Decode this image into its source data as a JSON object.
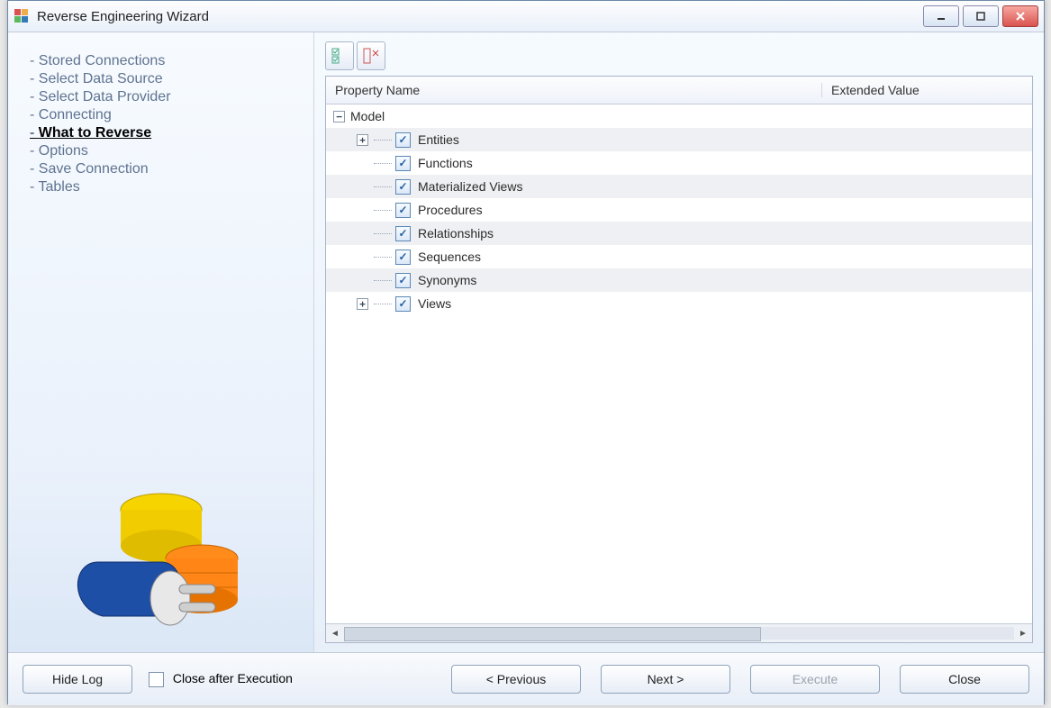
{
  "window": {
    "title": "Reverse Engineering Wizard"
  },
  "sidebar": {
    "steps": [
      "Stored Connections",
      "Select Data Source",
      "Select Data Provider",
      "Connecting",
      "What to Reverse",
      "Options",
      "Save Connection",
      "Tables"
    ],
    "current_index": 4
  },
  "toolbar": {
    "check_all": "check-all",
    "uncheck_all": "uncheck-all"
  },
  "grid": {
    "columns": {
      "property": "Property Name",
      "extended": "Extended Value"
    },
    "root": "Model",
    "items": [
      {
        "label": "Entities",
        "checked": true,
        "expandable": true
      },
      {
        "label": "Functions",
        "checked": true,
        "expandable": false
      },
      {
        "label": "Materialized Views",
        "checked": true,
        "expandable": false
      },
      {
        "label": "Procedures",
        "checked": true,
        "expandable": false
      },
      {
        "label": "Relationships",
        "checked": true,
        "expandable": false
      },
      {
        "label": "Sequences",
        "checked": true,
        "expandable": false
      },
      {
        "label": "Synonyms",
        "checked": true,
        "expandable": false
      },
      {
        "label": "Views",
        "checked": true,
        "expandable": true
      }
    ]
  },
  "footer": {
    "hide_log": "Hide Log",
    "close_after": "Close after Execution",
    "previous": "< Previous",
    "next": "Next >",
    "execute": "Execute",
    "close": "Close"
  }
}
